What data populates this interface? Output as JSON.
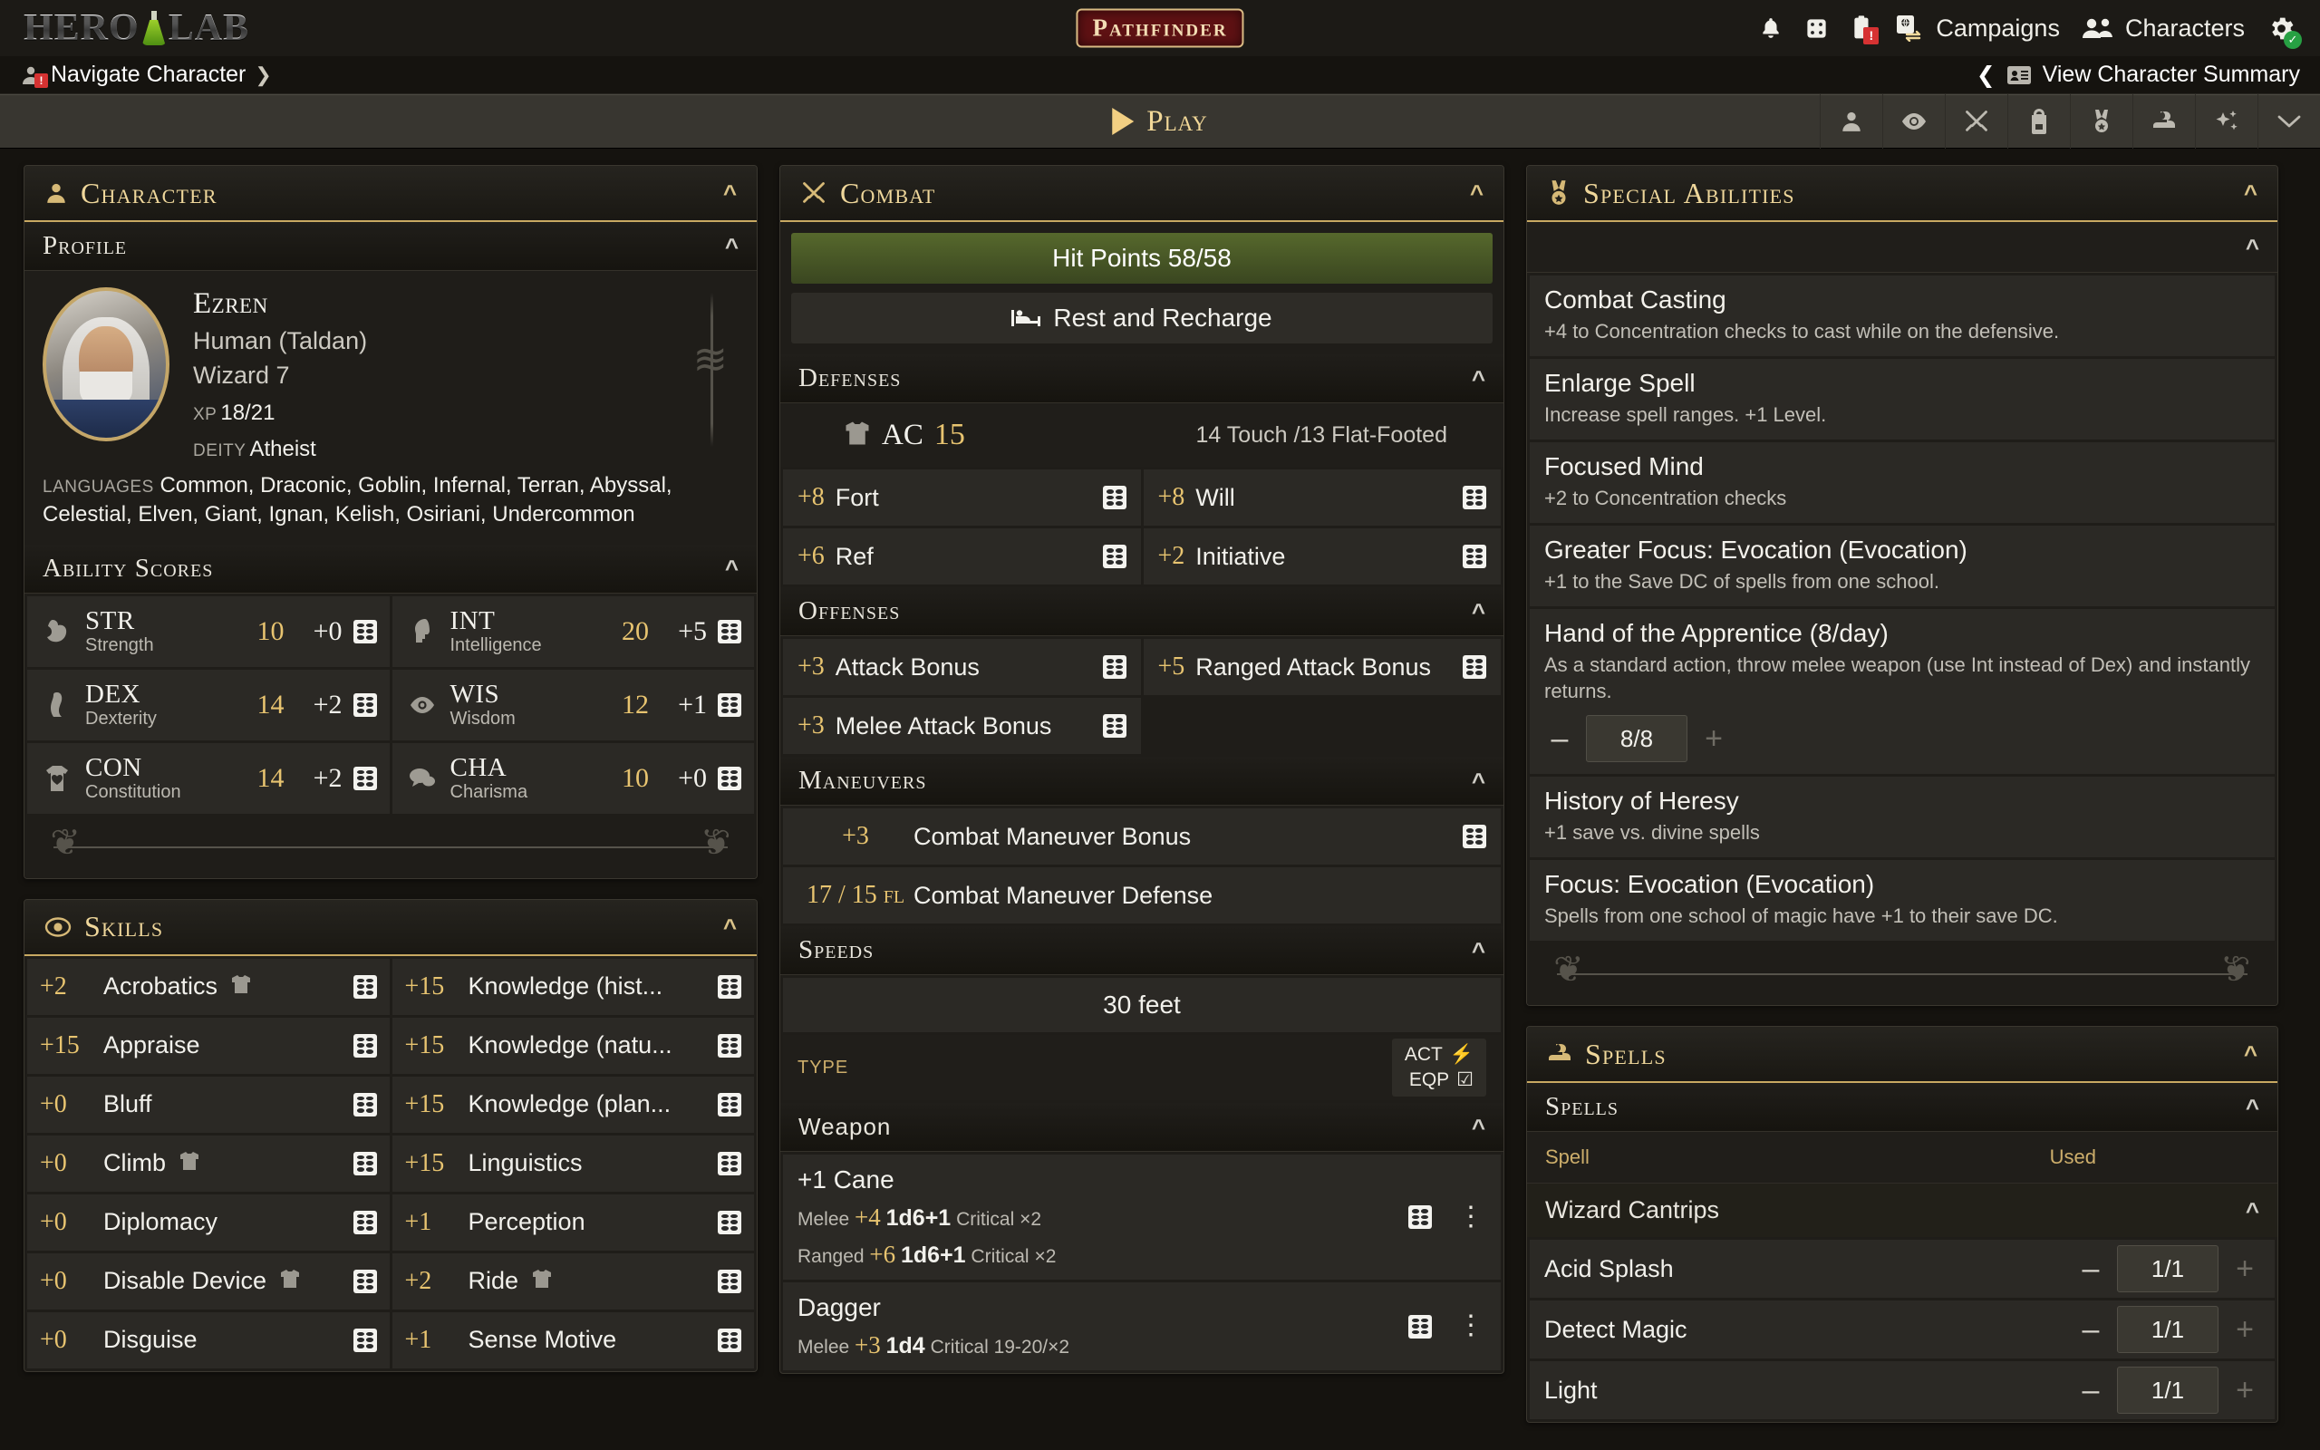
{
  "header": {
    "brand": "HERO LAB",
    "game_logo": "Pathfinder",
    "icons": [
      "bell-icon",
      "dice-icon",
      "clipboard-alert-icon"
    ],
    "campaigns_label": "Campaigns",
    "characters_label": "Characters",
    "settings_icon": "gear-icon"
  },
  "breadcrumb": {
    "label": "Navigate Character",
    "summary_label": "View Character Summary"
  },
  "playbar": {
    "label": "Play",
    "tools": [
      "person-icon",
      "eye-icon",
      "crossed-swords-icon",
      "backpack-icon",
      "medal-icon",
      "hand-spell-icon",
      "sparkles-icon",
      "chevron-down-icon"
    ]
  },
  "character_panel": {
    "title": "Character",
    "profile_title": "Profile",
    "name": "Ezren",
    "ancestry": "Human (Taldan)",
    "class_level": "Wizard 7",
    "xp_label": "XP",
    "xp_value": "18/21",
    "deity_label": "DEITY",
    "deity_value": "Atheist",
    "languages_label": "LANGUAGES",
    "languages_value": "Common, Draconic, Goblin, Infernal, Terran, Abyssal, Celestial, Elven, Giant, Ignan, Kelish, Osiriani, Undercommon"
  },
  "ability_scores": {
    "title": "Ability Scores",
    "items": [
      {
        "abbr": "STR",
        "full": "Strength",
        "score": "10",
        "mod": "+0",
        "icon": "muscle-icon"
      },
      {
        "abbr": "INT",
        "full": "Intelligence",
        "score": "20",
        "mod": "+5",
        "icon": "head-brain-icon"
      },
      {
        "abbr": "DEX",
        "full": "Dexterity",
        "score": "14",
        "mod": "+2",
        "icon": "leg-icon"
      },
      {
        "abbr": "WIS",
        "full": "Wisdom",
        "score": "12",
        "mod": "+1",
        "icon": "eye-icon"
      },
      {
        "abbr": "CON",
        "full": "Constitution",
        "score": "14",
        "mod": "+2",
        "icon": "heart-torso-icon"
      },
      {
        "abbr": "CHA",
        "full": "Charisma",
        "score": "10",
        "mod": "+0",
        "icon": "speech-bubbles-icon"
      }
    ]
  },
  "skills": {
    "title": "Skills",
    "items": [
      {
        "mod": "+2",
        "name": "Acrobatics",
        "armor": true
      },
      {
        "mod": "+15",
        "name": "Knowledge (hist...",
        "armor": false
      },
      {
        "mod": "+15",
        "name": "Appraise",
        "armor": false
      },
      {
        "mod": "+15",
        "name": "Knowledge (natu...",
        "armor": false
      },
      {
        "mod": "+0",
        "name": "Bluff",
        "armor": false
      },
      {
        "mod": "+15",
        "name": "Knowledge (plan...",
        "armor": false
      },
      {
        "mod": "+0",
        "name": "Climb",
        "armor": true
      },
      {
        "mod": "+15",
        "name": "Linguistics",
        "armor": false
      },
      {
        "mod": "+0",
        "name": "Diplomacy",
        "armor": false
      },
      {
        "mod": "+1",
        "name": "Perception",
        "armor": false
      },
      {
        "mod": "+0",
        "name": "Disable Device",
        "armor": true
      },
      {
        "mod": "+2",
        "name": "Ride",
        "armor": true
      },
      {
        "mod": "+0",
        "name": "Disguise",
        "armor": false
      },
      {
        "mod": "+1",
        "name": "Sense Motive",
        "armor": false
      }
    ]
  },
  "combat": {
    "title": "Combat",
    "hit_points": "Hit Points 58/58",
    "rest_label": "Rest and Recharge",
    "defenses_title": "Defenses",
    "ac_label": "AC",
    "ac_value": "15",
    "ac_detail": "14 Touch /13 Flat-Footed",
    "defense_stats": [
      {
        "mod": "+8",
        "name": "Fort"
      },
      {
        "mod": "+8",
        "name": "Will"
      },
      {
        "mod": "+6",
        "name": "Ref"
      },
      {
        "mod": "+2",
        "name": "Initiative"
      }
    ],
    "offenses_title": "Offenses",
    "offense_stats": [
      {
        "mod": "+3",
        "name": "Attack Bonus"
      },
      {
        "mod": "+5",
        "name": "Ranged Attack Bonus"
      },
      {
        "mod": "+3",
        "name": "Melee Attack Bonus"
      }
    ],
    "maneuvers_title": "Maneuvers",
    "maneuvers": [
      {
        "value": "+3",
        "suffix": "",
        "name": "Combat Maneuver Bonus",
        "die": true
      },
      {
        "value": "17 / 15",
        "suffix": "FL",
        "name": "Combat Maneuver Defense",
        "die": false
      }
    ],
    "speeds_title": "Speeds",
    "speed_value": "30 feet",
    "type_label": "TYPE",
    "act_label": "ACT",
    "eqp_label": "EQP",
    "weapon_title": "Weapon",
    "weapons": [
      {
        "name": "+1 Cane",
        "lines": [
          {
            "kind": "Melee",
            "bonus": "+4",
            "damage": "1d6+1",
            "crit_label": "Critical",
            "crit": "×2"
          },
          {
            "kind": "Ranged",
            "bonus": "+6",
            "damage": "1d6+1",
            "crit_label": "Critical",
            "crit": "×2"
          }
        ]
      },
      {
        "name": "Dagger",
        "lines": [
          {
            "kind": "Melee",
            "bonus": "+3",
            "damage": "1d4",
            "crit_label": "Critical",
            "crit": "19-20/×2"
          }
        ]
      }
    ]
  },
  "special_abilities": {
    "title": "Special Abilities",
    "items": [
      {
        "name": "Combat Casting",
        "desc": "+4 to Concentration checks to cast while on the defensive."
      },
      {
        "name": "Enlarge Spell",
        "desc": "Increase spell ranges. +1 Level."
      },
      {
        "name": "Focused Mind",
        "desc": "+2 to Concentration checks"
      },
      {
        "name": "Greater Focus: Evocation (Evocation)",
        "desc": "+1 to the Save DC of spells from one school."
      },
      {
        "name": "Hand of the Apprentice (8/day)",
        "desc": "As a standard action, throw melee weapon (use Int instead of Dex) and instantly returns.",
        "counter": "8/8"
      },
      {
        "name": "History of Heresy",
        "desc": "+1 save vs. divine spells"
      },
      {
        "name": "Focus: Evocation (Evocation)",
        "desc": "Spells from one school of magic have +1 to their save DC."
      }
    ]
  },
  "spells": {
    "title": "Spells",
    "sub_title": "Spells",
    "col_spell": "Spell",
    "col_used": "Used",
    "group": "Wizard Cantrips",
    "items": [
      {
        "name": "Acid Splash",
        "used": "1/1"
      },
      {
        "name": "Detect Magic",
        "used": "1/1"
      },
      {
        "name": "Light",
        "used": "1/1"
      }
    ]
  },
  "colors": {
    "gold": "#e8c470",
    "panel_border_gold": "#c8a962",
    "hp_green": "#4a5a28",
    "alert_red": "#d63232",
    "ok_green": "#27a043"
  }
}
